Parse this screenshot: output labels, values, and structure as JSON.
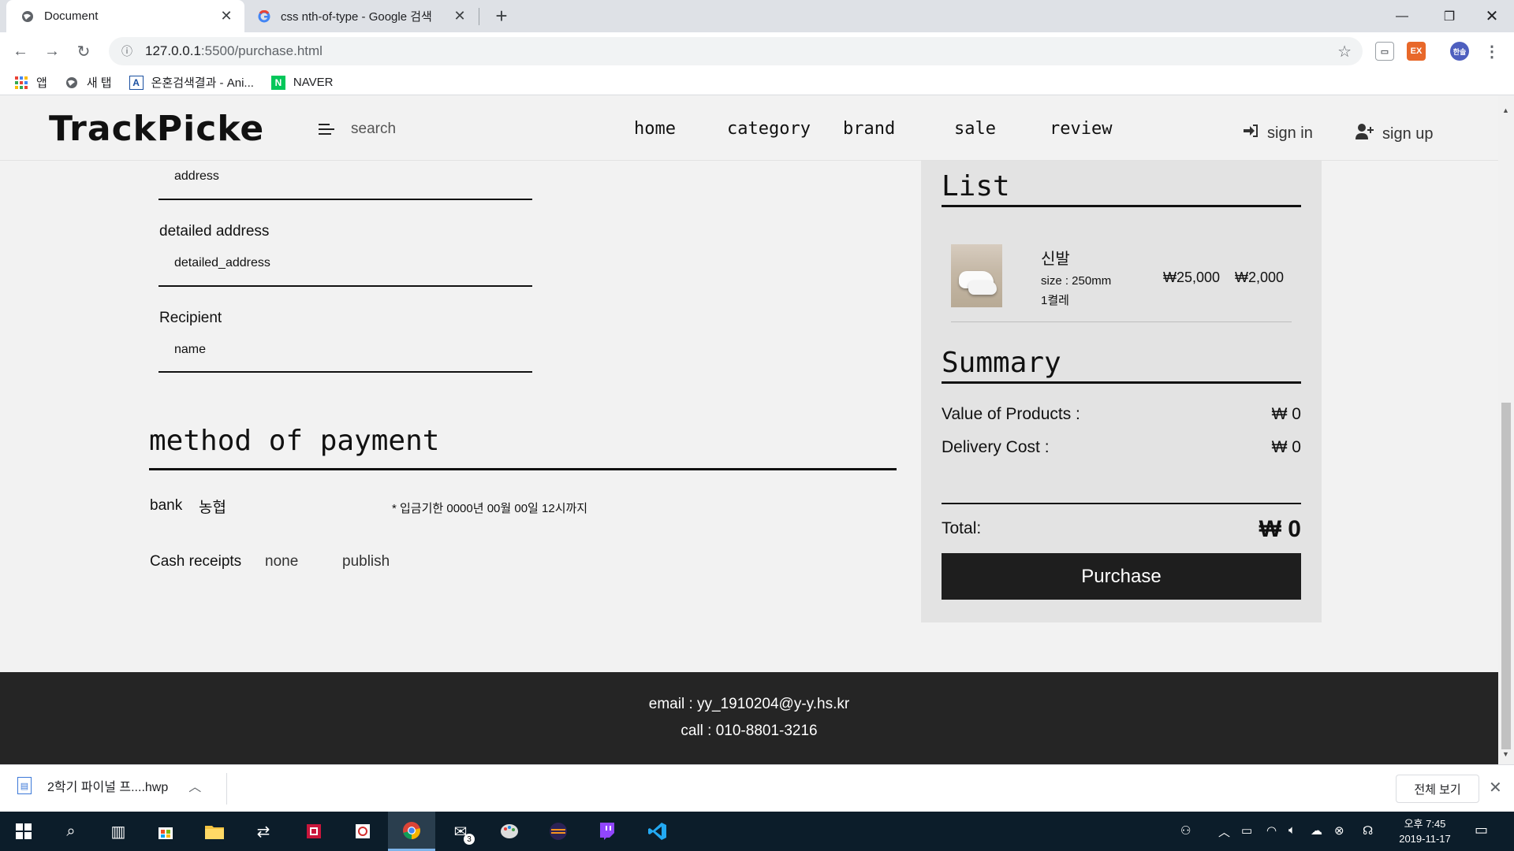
{
  "browser": {
    "tabs": [
      {
        "title": "Document",
        "icon": "globe-icon"
      },
      {
        "title": "css nth-of-type - Google 검색",
        "icon": "google-icon"
      }
    ],
    "url_host": "127.0.0.1",
    "url_path": ":5500/purchase.html",
    "bookmarks": [
      {
        "label": "앱",
        "icon": "apps-grid-icon"
      },
      {
        "label": "새 탭",
        "icon": "globe-icon"
      },
      {
        "label": "온혼검색결과 - Ani...",
        "icon": "letter-a-icon"
      },
      {
        "label": "NAVER",
        "icon": "naver-icon"
      }
    ],
    "profile_initials": "한솔"
  },
  "header": {
    "logo": "TrackPicke",
    "search_label": "search",
    "nav": [
      "home",
      "category",
      "brand",
      "sale",
      "review"
    ],
    "sign_in": "sign in",
    "sign_up": "sign up"
  },
  "form": {
    "address_value": "address",
    "detailed_address_label": "detailed address",
    "detailed_address_value": "detailed_address",
    "recipient_label": "Recipient",
    "recipient_value": "name",
    "payment_title": "method of payment",
    "bank_label": "bank",
    "bank_name": "농협",
    "deadline_note": "* 입금기한 0000년 00월 00일 12시까지",
    "cash_receipts_label": "Cash receipts",
    "cash_receipt_options": [
      "none",
      "publish"
    ]
  },
  "order": {
    "list_title": "List",
    "item": {
      "name": "신발",
      "size": "size : 250mm",
      "quantity": "1켤레",
      "price": "₩25,000",
      "delivery": "₩2,000"
    },
    "summary_title": "Summary",
    "value_of_products_label": "Value of Products :",
    "value_of_products": "₩ 0",
    "delivery_cost_label": "Delivery Cost :",
    "delivery_cost": "₩ 0",
    "total_label": "Total:",
    "total": "₩ 0",
    "purchase_label": "Purchase"
  },
  "footer": {
    "email": "email : yy_1910204@y-y.hs.kr",
    "call": "call : 010-8801-3216"
  },
  "download": {
    "filename": "2학기 파이널 프....hwp",
    "show_all": "전체 보기"
  },
  "taskbar": {
    "time": "오후 7:45",
    "date": "2019-11-17",
    "mail_badge": "3"
  }
}
